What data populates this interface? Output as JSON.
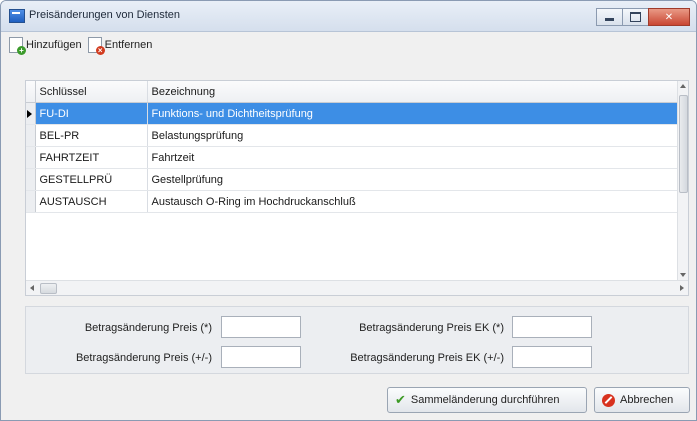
{
  "window": {
    "title": "Preisänderungen von Diensten"
  },
  "toolbar": {
    "add_label": "Hinzufügen",
    "remove_label": "Entfernen"
  },
  "grid": {
    "columns": [
      "Schlüssel",
      "Bezeichnung"
    ],
    "rows": [
      {
        "key": "FU-DI",
        "name": "Funktions- und Dichtheitsprüfung",
        "selected": true
      },
      {
        "key": "BEL-PR",
        "name": "Belastungsprüfung",
        "selected": false
      },
      {
        "key": "FAHRTZEIT",
        "name": "Fahrtzeit",
        "selected": false
      },
      {
        "key": "GESTELLPRÜ",
        "name": "Gestellprüfung",
        "selected": false
      },
      {
        "key": "AUSTAUSCH",
        "name": "Austausch O-Ring im Hochdruckanschluß",
        "selected": false
      }
    ]
  },
  "form": {
    "price_pct_label": "Betragsänderung Preis (*)",
    "price_abs_label": "Betragsänderung Preis (+/-)",
    "ek_pct_label": "Betragsänderung Preis EK (*)",
    "ek_abs_label": "Betragsänderung Preis EK (+/-)",
    "price_pct_value": "",
    "price_abs_value": "",
    "ek_pct_value": "",
    "ek_abs_value": ""
  },
  "buttons": {
    "apply_label": "Sammeländerung durchführen",
    "cancel_label": "Abbrechen"
  },
  "colors": {
    "selection": "#3d8ee5",
    "close_button": "#c94632"
  }
}
